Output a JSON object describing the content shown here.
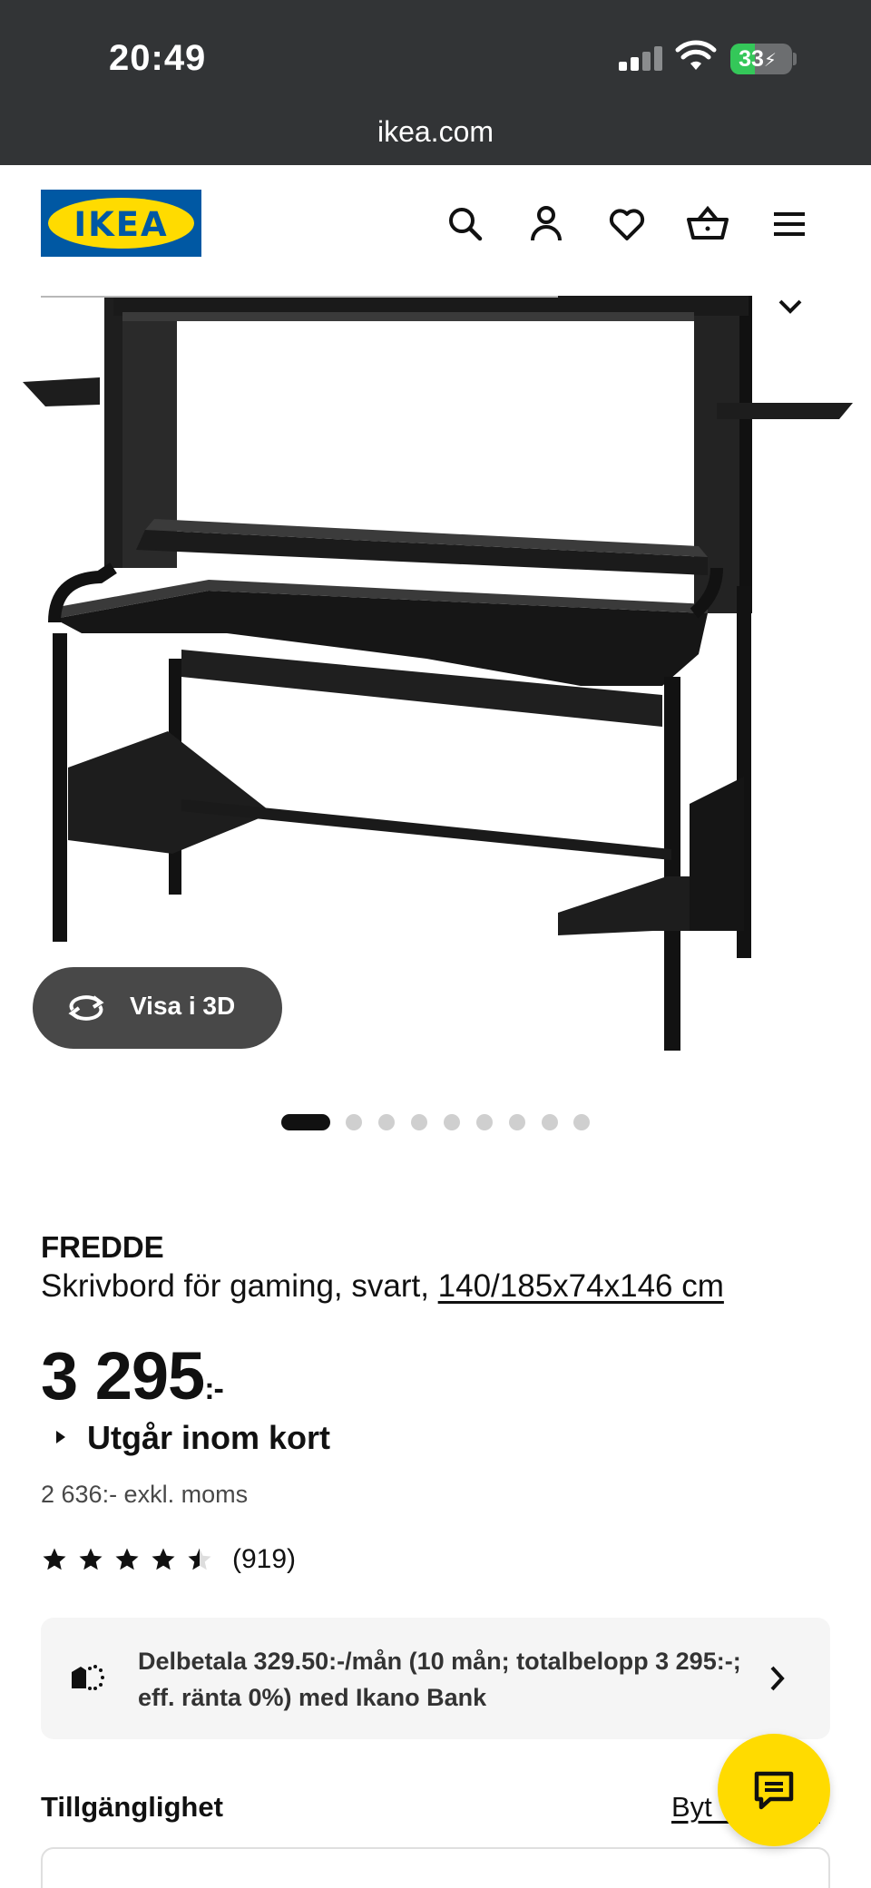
{
  "status_bar": {
    "time": "20:49",
    "battery": "33"
  },
  "browser": {
    "url": "ikea.com"
  },
  "header": {
    "logo_text": "IKEA",
    "icons": [
      "search-icon",
      "account-icon",
      "heart-icon",
      "basket-icon",
      "menu-icon"
    ]
  },
  "gallery": {
    "view_3d_label": "Visa i 3D",
    "image_count": 10,
    "active_index": 0
  },
  "product": {
    "name": "FREDDE",
    "description": "Skrivbord för gaming, svart, ",
    "dimensions": "140/185x74x146 cm",
    "price_main": "3 295",
    "price_suffix": ":-",
    "stock_notice": "Utgår inom kort",
    "price_excl_vat": "2 636:- exkl. moms",
    "rating": 4.5,
    "review_count": "(919)"
  },
  "financing": {
    "text": "Delbetala 329.50:-/mån (10 mån; totalbelopp 3 295:-; eff. ränta 0%) med Ikano Bank"
  },
  "availability": {
    "title": "Tillgänglighet",
    "change_store": "Byt varuhus"
  },
  "colors": {
    "brand_blue": "#0058a3",
    "brand_yellow": "#ffdb00",
    "topbar": "#323436"
  }
}
